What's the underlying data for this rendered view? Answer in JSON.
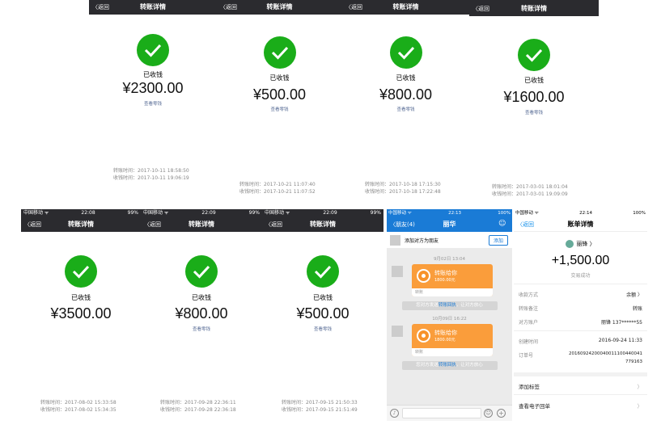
{
  "colors": {
    "success_green": "#1aad19",
    "wechat_nav": "#2b2b2f",
    "link_blue": "#576b95",
    "chat_blue": "#1a7bd6",
    "transfer_orange": "#fa9d3b"
  },
  "icons": {
    "success": "check-circle-icon",
    "back": "chevron-left-icon"
  },
  "top_panels": [
    {
      "back": "〈返回",
      "title": "转账详情",
      "status": "已收钱",
      "amount": "¥2300.00",
      "link": "查看零钱",
      "transfer_time": "转账时间：2017-10-11 18:58:50",
      "receive_time": "收钱时间：2017-10-11 19:06:19"
    },
    {
      "back": "〈返回",
      "title": "转账详情",
      "status": "已收钱",
      "amount": "¥500.00",
      "link": "查看零钱",
      "transfer_time": "转账时间：2017-10-21 11:07:40",
      "receive_time": "收钱时间：2017-10-21 11:07:52"
    },
    {
      "back": "〈返回",
      "title": "转账详情",
      "status": "已收钱",
      "amount": "¥800.00",
      "link": "查看零钱",
      "transfer_time": "转账时间：2017-10-18 17:15:30",
      "receive_time": "收钱时间：2017-10-18 17:22:48"
    },
    {
      "back": "〈返回",
      "title": "转账详情",
      "status": "已收钱",
      "amount": "¥1600.00",
      "link": "查看零钱",
      "transfer_time": "转账时间：2017-03-01 18:01:04",
      "receive_time": "收钱时间：2017-03-01 19:09:09"
    }
  ],
  "bottom_panels": [
    {
      "carrier": "中国移动 ᯤ",
      "time": "22:08",
      "battery": "99%",
      "back": "〈返回",
      "title": "转账详情",
      "status": "已收钱",
      "amount": "¥3500.00",
      "link": "",
      "transfer_time": "转账时间：2017-08-02 15:33:58",
      "receive_time": "收钱时间：2017-08-02 15:34:35"
    },
    {
      "carrier": "中国移动 ᯤ",
      "time": "22:09",
      "battery": "99%",
      "back": "〈返回",
      "title": "转账详情",
      "status": "已收钱",
      "amount": "¥800.00",
      "link": "查看零钱",
      "transfer_time": "转账时间：2017-09-28 22:36:11",
      "receive_time": "收钱时间：2017-09-28 22:36:18"
    },
    {
      "carrier": "中国移动 ᯤ",
      "time": "22:09",
      "battery": "99%",
      "back": "〈返回",
      "title": "转账详情",
      "status": "已收钱",
      "amount": "¥500.00",
      "link": "查看零钱",
      "transfer_time": "转账时间：2017-09-15 21:50:33",
      "receive_time": "收钱时间：2017-09-15 21:51:49"
    }
  ],
  "chat": {
    "carrier": "中国移动 ᯤ",
    "time": "22:13",
    "battery": "100%",
    "back": "〈朋友(4)",
    "title": "丽华",
    "add_text": "添加对方为朋友",
    "add_button": "添加",
    "messages": [
      {
        "date": "9月02日 13:04",
        "title": "转账给你",
        "amount": "1800.00元",
        "foot": "转账",
        "system": "您对方发送",
        "system_link": "转账回执",
        "system_tail": "，让对方放心"
      },
      {
        "date": "10月09日 16:22",
        "title": "转账给你",
        "amount": "1800.00元",
        "foot": "转账",
        "system": "您对方发送",
        "system_link": "转账回执",
        "system_tail": "，让对方放心"
      }
    ]
  },
  "alipay": {
    "carrier": "中国移动 ᯤ",
    "time": "22:14",
    "battery": "100%",
    "back": "〈返回",
    "title": "账单详情",
    "name": "丽锋 〉",
    "amount": "+1,500.00",
    "status": "交易成功",
    "rows": [
      {
        "label": "收款方式",
        "value": "余额 〉"
      },
      {
        "label": "转账备注",
        "value": "转账"
      },
      {
        "label": "对方账户",
        "value": "丽锋 137******55"
      }
    ],
    "rows2": [
      {
        "label": "创建时间",
        "value": "2016-09-24 11:33"
      },
      {
        "label": "订单号",
        "value": "20160924200040011100440041"
      },
      {
        "label": "",
        "value": "779163"
      }
    ],
    "menu": [
      {
        "label": "添加标签",
        "chev": "〉"
      },
      {
        "label": "查看电子回单",
        "chev": "〉"
      }
    ]
  }
}
